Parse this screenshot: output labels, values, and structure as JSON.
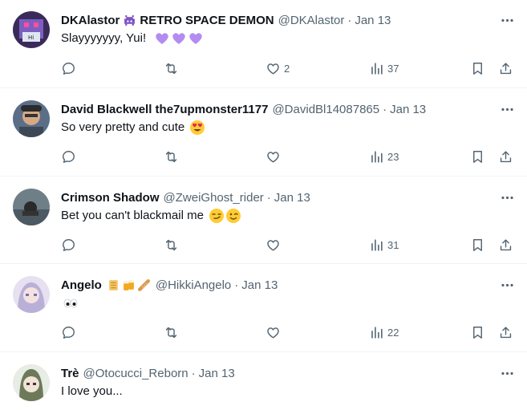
{
  "tweets": [
    {
      "name": "DKAlastor",
      "name_suffix": "RETRO SPACE DEMON",
      "handle": "@DKAlastor",
      "time": "Jan 13",
      "text": "Slayyyyyyy, Yui!",
      "likes": "2",
      "views": "37"
    },
    {
      "name": "David Blackwell the7upmonster1177",
      "handle": "@DavidBl14087865",
      "time": "Jan 13",
      "text": "So very pretty and cute",
      "likes": "",
      "views": "23"
    },
    {
      "name": "Crimson Shadow",
      "handle": "@ZweiGhost_rider",
      "time": "Jan 13",
      "text": "Bet you can't blackmail me",
      "likes": "",
      "views": "31"
    },
    {
      "name": "Angelo",
      "handle": "@HikkiAngelo",
      "time": "Jan 13",
      "text": "",
      "likes": "",
      "views": "22"
    },
    {
      "name": "Trè",
      "handle": "@Otocucci_Reborn",
      "time": "Jan 13",
      "text": "I love you..."
    }
  ],
  "colors": {
    "secondary_text": "#536471",
    "divider": "#eff3f4",
    "primary_text": "#0f1419"
  },
  "icons": [
    "reply-icon",
    "retweet-icon",
    "like-icon",
    "views-icon",
    "bookmark-icon",
    "share-icon",
    "more-icon"
  ]
}
